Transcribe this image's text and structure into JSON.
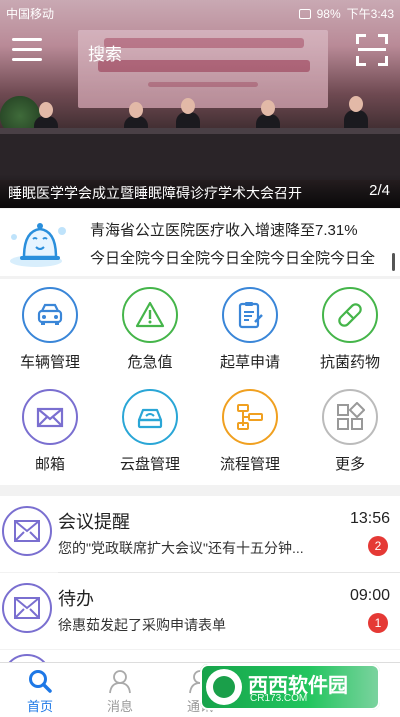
{
  "status_bar": {
    "carrier": "中国移动",
    "battery": "98%",
    "time": "下午3:43"
  },
  "header": {
    "search_label": "搜索"
  },
  "banner": {
    "caption": "睡眠医学学会成立暨睡眠障碍诊疗学术大会召开",
    "page": "2/4"
  },
  "notice": {
    "line1": "青海省公立医院医疗收入增速降至7.31%",
    "line2": "今日全院今日全院今日全院今日全院今日全"
  },
  "grid": {
    "items": [
      {
        "label": "车辆管理",
        "icon": "car-icon",
        "color": "#3a86d8"
      },
      {
        "label": "危急值",
        "icon": "warning-icon",
        "color": "#45b54a"
      },
      {
        "label": "起草申请",
        "icon": "clipboard-edit-icon",
        "color": "#3a86d8"
      },
      {
        "label": "抗菌药物",
        "icon": "pill-icon",
        "color": "#45b54a"
      },
      {
        "label": "邮箱",
        "icon": "mail-icon",
        "color": "#7a6fd0"
      },
      {
        "label": "云盘管理",
        "icon": "cloud-disk-icon",
        "color": "#2aa6d6"
      },
      {
        "label": "流程管理",
        "icon": "workflow-icon",
        "color": "#f0a020"
      },
      {
        "label": "更多",
        "icon": "more-grid-icon",
        "color": "#999999"
      }
    ]
  },
  "messages": [
    {
      "title": "会议提醒",
      "time": "13:56",
      "subtitle": "您的\"党政联席扩大会议\"还有十五分钟...",
      "badge": "2"
    },
    {
      "title": "待办",
      "time": "09:00",
      "subtitle": "徐惠茹发起了采购申请表单",
      "badge": "1"
    }
  ],
  "bottom_nav": {
    "items": [
      {
        "label": "首页",
        "icon": "search-home-icon",
        "active": true
      },
      {
        "label": "消息",
        "icon": "person-icon",
        "active": false
      },
      {
        "label": "通讯",
        "icon": "contacts-icon",
        "active": false
      }
    ]
  },
  "watermark": {
    "text": "西西软件园",
    "url": "CR173.COM"
  }
}
